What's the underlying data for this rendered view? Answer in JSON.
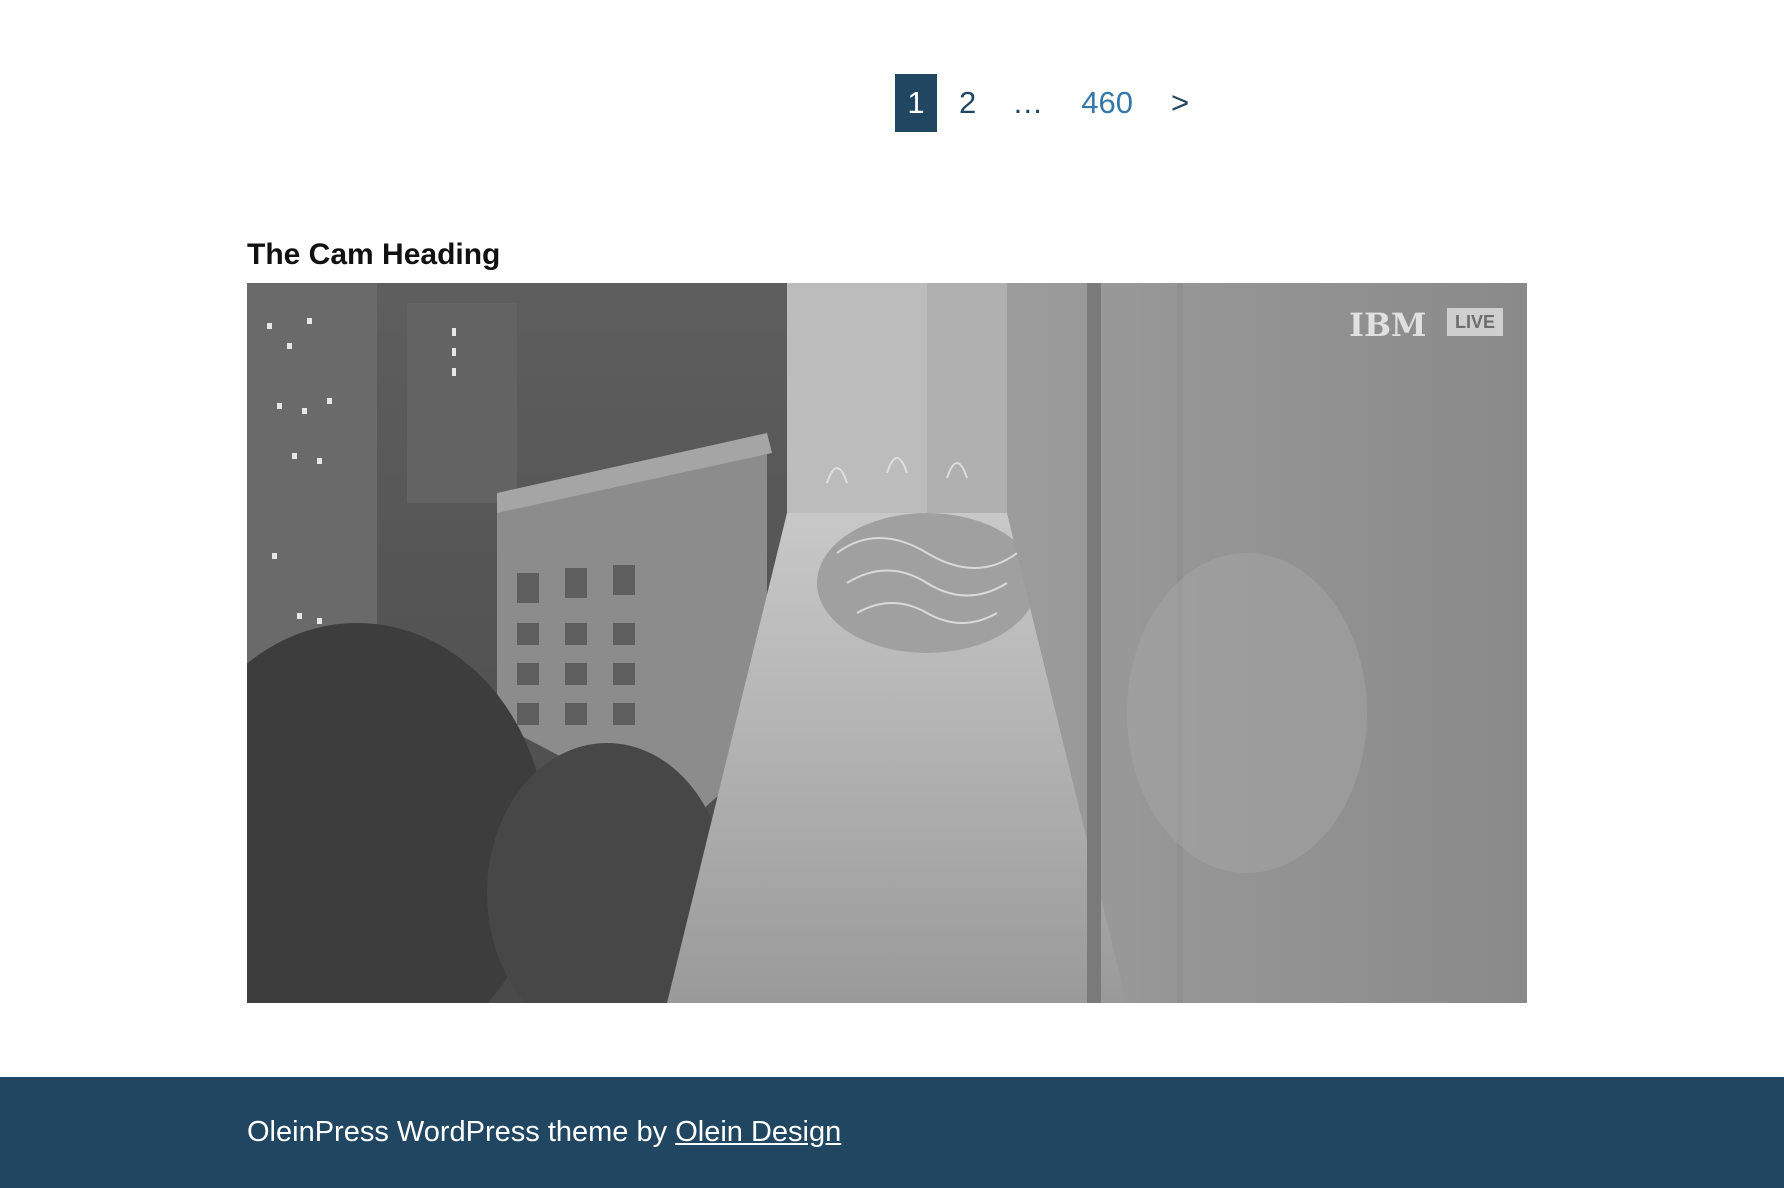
{
  "pagination": {
    "current": "1",
    "next_page": "2",
    "ellipsis": "…",
    "last_page": "460",
    "next_arrow": ">"
  },
  "cam": {
    "heading": "The Cam Heading",
    "brand": "IBM",
    "live_badge": "LIVE"
  },
  "footer": {
    "text_prefix": "OleinPress WordPress theme by ",
    "link_label": "Olein Design"
  },
  "colors": {
    "primary": "#214662",
    "link": "#3477ab",
    "background": "#ffffff"
  }
}
